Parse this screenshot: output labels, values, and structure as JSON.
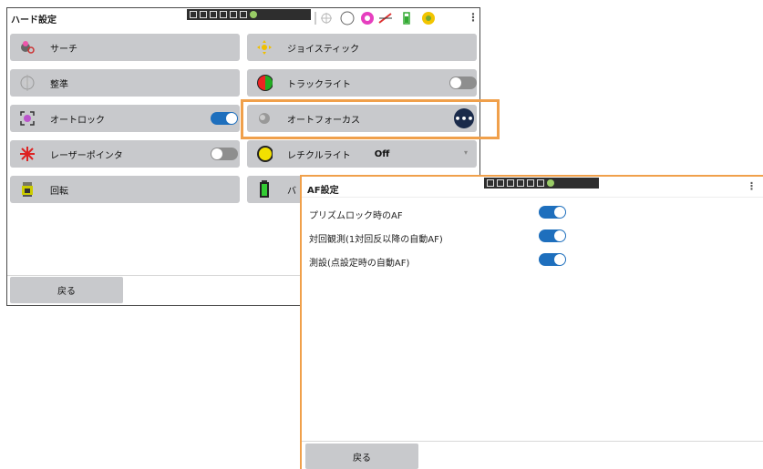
{
  "main_window": {
    "title": "ハード設定",
    "buttons": {
      "search": "サーチ",
      "joystick": "ジョイスティック",
      "leveling": "整準",
      "track_light": "トラックライト",
      "auto_lock": "オートロック",
      "auto_focus": "オートフォーカス",
      "laser_pointer": "レーザーポインタ",
      "reticle_light": "レチクルライト",
      "reticle_value": "Off",
      "rotate": "回転",
      "battery_partial": "バ"
    },
    "back_label": "戻る",
    "toggles": {
      "track_light": false,
      "auto_lock": true,
      "laser_pointer": false
    }
  },
  "af_window": {
    "title": "AF設定",
    "rows": [
      {
        "label": "プリズムロック時のAF",
        "on": true
      },
      {
        "label": "対回観測(1対回反以降の自動AF)",
        "on": true
      },
      {
        "label": "測設(点設定時の自動AF)",
        "on": true
      }
    ],
    "back_label": "戻る"
  },
  "colors": {
    "toggle_on": "#1e6fbd",
    "highlight": "#f0a04b",
    "button_bg": "#c8c9cc"
  }
}
